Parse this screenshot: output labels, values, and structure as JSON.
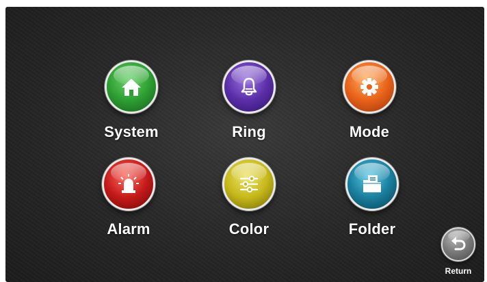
{
  "menu": {
    "items": [
      {
        "label": "System",
        "icon": "home-icon",
        "color": "#2e9e33"
      },
      {
        "label": "Ring",
        "icon": "bell-icon",
        "color": "#5b2ea8"
      },
      {
        "label": "Mode",
        "icon": "gear-icon",
        "color": "#e8621a"
      },
      {
        "label": "Alarm",
        "icon": "siren-icon",
        "color": "#c41a1a"
      },
      {
        "label": "Color",
        "icon": "sliders-icon",
        "color": "#c6b81a"
      },
      {
        "label": "Folder",
        "icon": "folder-icon",
        "color": "#1a7f9e"
      }
    ]
  },
  "return_button": {
    "label": "Return",
    "icon": "return-arrow-icon"
  }
}
